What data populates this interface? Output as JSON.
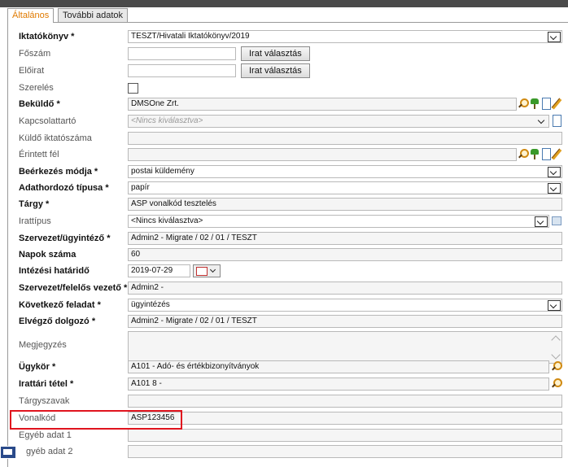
{
  "tabs": [
    {
      "label": "Általános"
    },
    {
      "label": "További adatok"
    }
  ],
  "buttons": {
    "irat_valasztas": "Irat választás"
  },
  "fields": {
    "iktatokonyv": {
      "label": "Iktatókönyv *",
      "value": "TESZT/Hivatali Iktatókönyv/2019"
    },
    "foszam": {
      "label": "Főszám",
      "value": ""
    },
    "eloirat": {
      "label": "Előirat",
      "value": ""
    },
    "szereles": {
      "label": "Szerelés"
    },
    "bekuldo": {
      "label": "Beküldő *",
      "value": "DMSOne Zrt."
    },
    "kapcsolattarto": {
      "label": "Kapcsolattartó",
      "value": "<Nincs kiválasztva>"
    },
    "kuldo_iktatoszama": {
      "label": "Küldő iktatószáma",
      "value": ""
    },
    "erintett_fel": {
      "label": "Érintett fél",
      "value": ""
    },
    "beerkezes_modja": {
      "label": "Beérkezés módja *",
      "value": "postai küldemény"
    },
    "adathordozo": {
      "label": "Adathordozó típusa *",
      "value": "papír"
    },
    "targy": {
      "label": "Tárgy *",
      "value": "ASP vonalkód tesztelés"
    },
    "irattipus": {
      "label": "Irattípus",
      "value": "<Nincs kiválasztva>"
    },
    "szervezet_ugyintezo": {
      "label": "Szervezet/ügyintéző *",
      "value": "Admin2 - Migrate / 02 / 01 / TESZT"
    },
    "napok_szama": {
      "label": "Napok száma",
      "value": "60"
    },
    "intezesi_hatarido": {
      "label": "Intézési határidő",
      "value": "2019-07-29"
    },
    "szervezet_felelos": {
      "label": "Szervezet/felelős vezető *",
      "value": "Admin2 -"
    },
    "kovetkezo_feladat": {
      "label": "Következő feladat *",
      "value": "ügyintézés"
    },
    "elvegzo_dolgozo": {
      "label": "Elvégző dolgozó *",
      "value": "Admin2 - Migrate / 02 / 01 / TESZT"
    },
    "megjegyzes": {
      "label": "Megjegyzés",
      "value": ""
    },
    "ugykor": {
      "label": "Ügykör *",
      "value": "A101 - Adó- és értékbizonyítványok"
    },
    "irattari_tetel": {
      "label": "Irattári tétel *",
      "value": "A101 8 -"
    },
    "targyszavak": {
      "label": "Tárgyszavak",
      "value": ""
    },
    "vonalkod": {
      "label": "Vonalkód",
      "value": "ASP123456"
    },
    "egyeb_adat_1": {
      "label": "Egyéb adat 1",
      "value": ""
    },
    "egyeb_adat_2": {
      "label": "gyéb adat 2",
      "value": ""
    }
  },
  "colors": {
    "active_tab": "#e07a00",
    "highlight": "#e0141e"
  }
}
